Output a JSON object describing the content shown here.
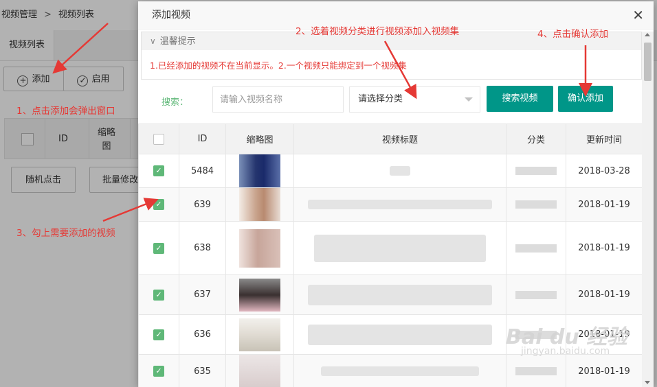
{
  "page": {
    "breadcrumb": [
      "视频管理",
      "视频列表"
    ],
    "breadcrumb_sep": ">",
    "tab": "视频列表",
    "toolbar": {
      "add": "添加",
      "enable": "启用"
    },
    "table_header": {
      "id": "ID",
      "thumb": "缩略图"
    },
    "buttons": {
      "random": "随机点击",
      "batch": "批量修改"
    }
  },
  "modal": {
    "title": "添加视频",
    "close_glyph": "✕",
    "tips_title": "温馨提示",
    "tips_text": "1.已经添加的视频不在当前显示。2.一个视频只能绑定到一个视频集",
    "search_label": "搜索：",
    "search_placeholder": "请输入视频名称",
    "category_select": "请选择分类",
    "search_button": "搜索视频",
    "confirm_button": "确认添加",
    "columns": [
      "ID",
      "缩略图",
      "视频标题",
      "分类",
      "更新时间"
    ],
    "rows": [
      {
        "id": "5484",
        "date": "2018-03-28",
        "checked": true
      },
      {
        "id": "639",
        "date": "2018-01-19",
        "checked": true
      },
      {
        "id": "638",
        "date": "2018-01-19",
        "checked": true
      },
      {
        "id": "637",
        "date": "2018-01-19",
        "checked": true
      },
      {
        "id": "636",
        "date": "2018-01-19",
        "checked": true
      },
      {
        "id": "635",
        "date": "2018-01-19",
        "checked": true
      }
    ]
  },
  "annotations": {
    "step1": "1、点击添加会弹出窗口",
    "step2": "2、选着视频分类进行视频添加入视频集",
    "step3": "3、勾上需要添加的视频",
    "step4": "4、点击确认添加"
  },
  "watermark": {
    "brand": "Bai du 经验",
    "url": "jingyan.baidu.com"
  },
  "colors": {
    "accent": "#009688",
    "check": "#5fb878",
    "annotation": "#e53935"
  }
}
